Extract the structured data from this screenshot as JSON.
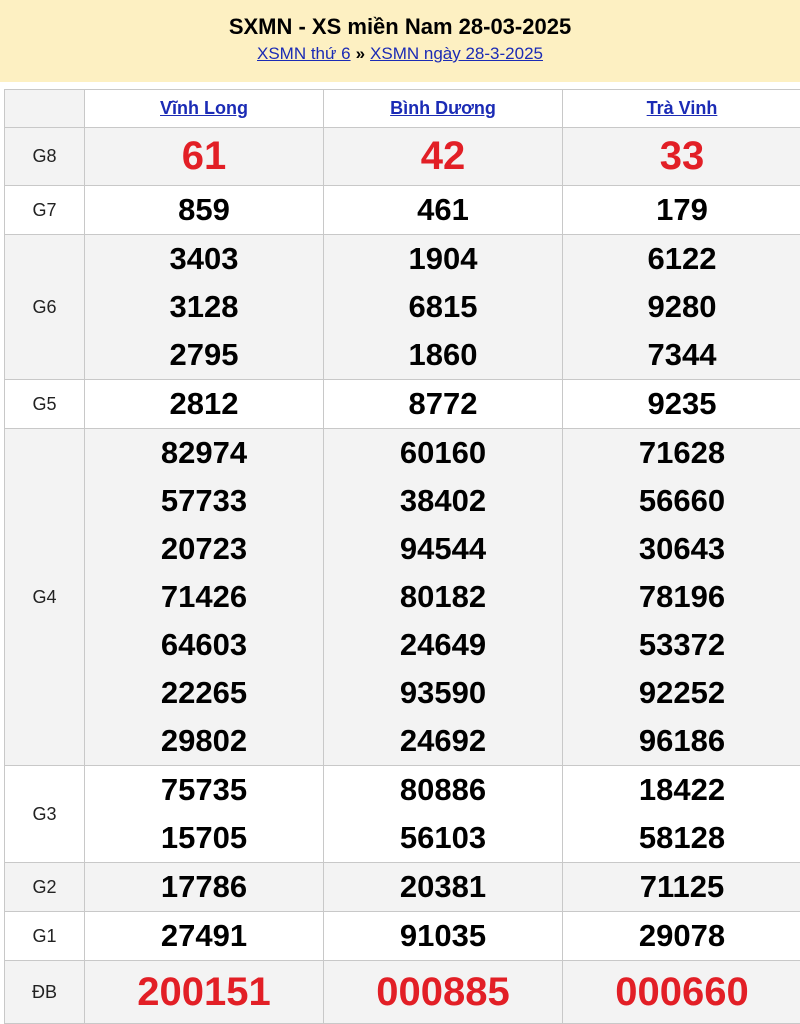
{
  "header": {
    "title": "SXMN - XS miền Nam 28-03-2025",
    "link1": "XSMN thứ 6",
    "separator": "»",
    "link2": "XSMN ngày 28-3-2025"
  },
  "provinces": [
    "Vĩnh Long",
    "Bình Dương",
    "Trà Vinh"
  ],
  "prizes": [
    {
      "label": "G8",
      "values": [
        [
          "61"
        ],
        [
          "42"
        ],
        [
          "33"
        ]
      ]
    },
    {
      "label": "G7",
      "values": [
        [
          "859"
        ],
        [
          "461"
        ],
        [
          "179"
        ]
      ]
    },
    {
      "label": "G6",
      "values": [
        [
          "3403",
          "3128",
          "2795"
        ],
        [
          "1904",
          "6815",
          "1860"
        ],
        [
          "6122",
          "9280",
          "7344"
        ]
      ]
    },
    {
      "label": "G5",
      "values": [
        [
          "2812"
        ],
        [
          "8772"
        ],
        [
          "9235"
        ]
      ]
    },
    {
      "label": "G4",
      "values": [
        [
          "82974",
          "57733",
          "20723",
          "71426",
          "64603",
          "22265",
          "29802"
        ],
        [
          "60160",
          "38402",
          "94544",
          "80182",
          "24649",
          "93590",
          "24692"
        ],
        [
          "71628",
          "56660",
          "30643",
          "78196",
          "53372",
          "92252",
          "96186"
        ]
      ]
    },
    {
      "label": "G3",
      "values": [
        [
          "75735",
          "15705"
        ],
        [
          "80886",
          "56103"
        ],
        [
          "18422",
          "58128"
        ]
      ]
    },
    {
      "label": "G2",
      "values": [
        [
          "17786"
        ],
        [
          "20381"
        ],
        [
          "71125"
        ]
      ]
    },
    {
      "label": "G1",
      "values": [
        [
          "27491"
        ],
        [
          "91035"
        ],
        [
          "29078"
        ]
      ]
    },
    {
      "label": "ĐB",
      "values": [
        [
          "200151"
        ],
        [
          "000885"
        ],
        [
          "000660"
        ]
      ]
    }
  ],
  "colors": {
    "header_bg": "#fdf0c2",
    "link": "#1b2bb5",
    "special_red": "#e21f26",
    "stripe": "#f3f3f3"
  }
}
